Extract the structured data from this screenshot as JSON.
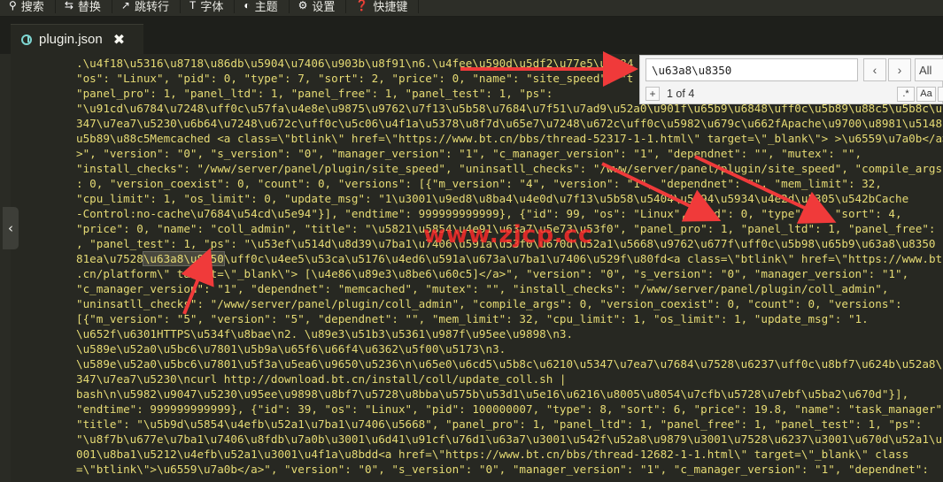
{
  "toolbar": {
    "items": [
      {
        "label": "搜索",
        "icon": "search-icon",
        "glyph": "⚲"
      },
      {
        "label": "替换",
        "icon": "replace-icon",
        "glyph": "⇆"
      },
      {
        "label": "跳转行",
        "icon": "goto-line-icon",
        "glyph": "↗"
      },
      {
        "label": "字体",
        "icon": "font-icon",
        "glyph": "T"
      },
      {
        "label": "主题",
        "icon": "theme-icon",
        "glyph": "◐"
      },
      {
        "label": "设置",
        "icon": "gear-icon",
        "glyph": "⚙"
      },
      {
        "label": "快捷键",
        "icon": "shortcut-icon",
        "glyph": "❓"
      }
    ]
  },
  "tab": {
    "title": "plugin.json",
    "close": "✖",
    "icon": "json-file-icon"
  },
  "collapse_glyph": "‹",
  "find": {
    "value": "\\u63a8\\u8350",
    "prev": "‹",
    "next": "›",
    "all": "All",
    "plus": "+",
    "count": "1 of 4",
    "regex": ".*",
    "case": "Aa"
  },
  "watermark": "www.zjcp.cc",
  "colors": {
    "editor_bg": "#272822",
    "string": "#e6db74",
    "arrow": "#f03a3a"
  },
  "code": {
    "lines": [
      {
        "pre": ".\\u4f18\\u5316\\u8718\\u86db\\u5904\\u7406\\u903b\\u8f91\\n6.\\u4fee\\u590d\\u5df2\\u77e5\\u7684"
      },
      {
        "pre": "\"os\": \"Linux\", \"pid\": 0, \"type\": 7, \"sort\": 2, \"price\": 0, \"name\": \"site_speed\", \"t"
      },
      {
        "pre": "\"panel_pro\": 1, \"panel_ltd\": 1, \"panel_free\": 1, \"panel_test\": 1, \"ps\":"
      },
      {
        "pre": "\"\\u91cd\\u6784\\u7248\\uff0c\\u57fa\\u4e8e\\u9875\\u9762\\u7f13\\u5b58\\u7684\\u7f51\\u7ad9\\u52a0\\u901f\\u65b9\\u6848\\uff0c\\u5b89\\u88c5\\u5b8c\\u6210\\u540e"
      },
      {
        "pre": "347\\u7ea7\\u5230\\u6b64\\u7248\\u672c\\uff0c\\u5c06\\u4f1a\\u5378\\u8f7d\\u65e7\\u7248\\u672c\\uff0c\\u5982\\u679c\\u662fApache\\u9700\\u8981\\u5148"
      },
      {
        "pre": "u5b89\\u88c5Memcached <a class=\\\"btlink\\\" href=\\\"https://www.bt.cn/bbs/thread-52317-1-1.html\\\" target=\\\"_blank\\\"> >\\u6559\\u7a0b</a>"
      },
      {
        "pre": ">\", \"version\": \"0\", \"s_version\": \"0\", \"manager_version\": \"1\", \"c_manager_version\": \"1\", \"dependnet\": \"\", \"mutex\": \"\","
      },
      {
        "pre": "\"install_checks\": \"/www/server/panel/plugin/site_speed\", \"uninsatll_checks\": \"/www/server/panel/plugin/site_speed\", \"compile_args\""
      },
      {
        "pre": ": 0, \"version_coexist\": 0, \"count\": 0, \"versions\": [{\"m_version\": \"4\", \"version\": \"1\", \"dependnet\": \"\", \"mem_limit\": 32,"
      },
      {
        "pre": "\"cpu_limit\": 1, \"os_limit\": 0, \"update_msg\": \"1\\u3001\\u9ed8\\u8ba4\\u4e0d\\u7f13\\u5b58\\u5404\\u5e94\\u5934\\u4e2d\\u5305\\u542bCache"
      },
      {
        "pre": "-Control:no-cache\\u7684\\u54cd\\u5e94\"}], \"endtime\": 999999999999}, {\"id\": 99, \"os\": \"Linux\", \"pid\": 0, \"type\": 7, \"sort\": 4,"
      },
      {
        "pre": "\"price\": 0, \"name\": \"coll_admin\", \"title\": \"\\u5821\\u5854\\u4e91\\u63a7\\u5e73\\u53f0\", \"panel_pro\": 1, \"panel_ltd\": 1, \"panel_free\": 1"
      },
      {
        "pre": ", \"panel_test\": 1, \"ps\": \"\\u53ef\\u514d\\u8d39\\u7ba1\\u7406\\u591a\\u53f0\\u670d\\u52a1\\u5668\\u9762\\u677f\\uff0c\\u5b98\\u65b9\\u63a8\\u8350"
      },
      {
        "pre": "81ea\\u7528",
        "hl": "\\u63a8\\u8350",
        "post": "\\uff0c\\u4ee5\\u53ca\\u5176\\u4ed6\\u591a\\u673a\\u7ba1\\u7406\\u529f\\u80fd<a class=\\\"btlink\\\" href=\\\"https://www.bt"
      },
      {
        "pre": ".cn/platform\\\" target=\\\"_blank\\\"> [\\u4e86\\u89e3\\u8be6\\u60c5]</a>\", \"version\": \"0\", \"s_version\": \"0\", \"manager_version\": \"1\","
      },
      {
        "pre": "\"c_manager_version\": \"1\", \"dependnet\": \"memcached\", \"mutex\": \"\", \"install_checks\": \"/www/server/panel/plugin/coll_admin\","
      },
      {
        "pre": "\"uninsatll_checks\": \"/www/server/panel/plugin/coll_admin\", \"compile_args\": 0, \"version_coexist\": 0, \"count\": 0, \"versions\":"
      },
      {
        "pre": "[{\"m_version\": \"5\", \"version\": \"5\", \"dependnet\": \"\", \"mem_limit\": 32, \"cpu_limit\": 1, \"os_limit\": 1, \"update_msg\": \"1."
      },
      {
        "pre": "\\u652f\\u6301HTTPS\\u534f\\u8bae\\n2. \\u89e3\\u51b3\\u5361\\u987f\\u95ee\\u9898\\n3."
      },
      {
        "pre": "\\u589e\\u52a0\\u5bc6\\u7801\\u5b9a\\u65f6\\u66f4\\u6362\\u5f00\\u5173\\n3."
      },
      {
        "pre": "\\u589e\\u52a0\\u5bc6\\u7801\\u5f3a\\u5ea6\\u9650\\u5236\\n\\u65e0\\u6cd5\\u5b8c\\u6210\\u5347\\u7ea7\\u7684\\u7528\\u6237\\uff0c\\u8bf7\\u624b\\u52a8\\u5347"
      },
      {
        "pre": "347\\u7ea7\\u5230\\ncurl http://download.bt.cn/install/coll/update_coll.sh |"
      },
      {
        "pre": "bash\\n\\u5982\\u9047\\u5230\\u95ee\\u9898\\u8bf7\\u5728\\u8bba\\u575b\\u53d1\\u5e16\\u6216\\u8005\\u8054\\u7cfb\\u5728\\u7ebf\\u5ba2\\u670d\"}],"
      },
      {
        "pre": "\"endtime\": 999999999999}, {\"id\": 39, \"os\": \"Linux\", \"pid\": 100000007, \"type\": 8, \"sort\": 6, \"price\": 19.8, \"name\": \"task_manager\","
      },
      {
        "pre": "\"title\": \"\\u5b9d\\u5854\\u4efb\\u52a1\\u7ba1\\u7406\\u5668\", \"panel_pro\": 1, \"panel_ltd\": 1, \"panel_free\": 1, \"panel_test\": 1, \"ps\":"
      },
      {
        "pre": "\"\\u8f7b\\u677e\\u7ba1\\u7406\\u8fdb\\u7a0b\\u3001\\u6d41\\u91cf\\u76d1\\u63a7\\u3001\\u542f\\u52a8\\u9879\\u3001\\u7528\\u6237\\u3001\\u670d\\u52a1\\u7b49"
      },
      {
        "pre": "001\\u8ba1\\u5212\\u4efb\\u52a1\\u3001\\u4f1a\\u8bdd<a href=\\\"https://www.bt.cn/bbs/thread-12682-1-1.html\\\" target=\\\"_blank\\\" class"
      },
      {
        "pre": "=\\\"btlink\\\">\\u6559\\u7a0b</a>\", \"version\": \"0\", \"s_version\": \"0\", \"manager_version\": \"1\", \"c_manager_version\": \"1\", \"dependnet\":"
      }
    ]
  }
}
